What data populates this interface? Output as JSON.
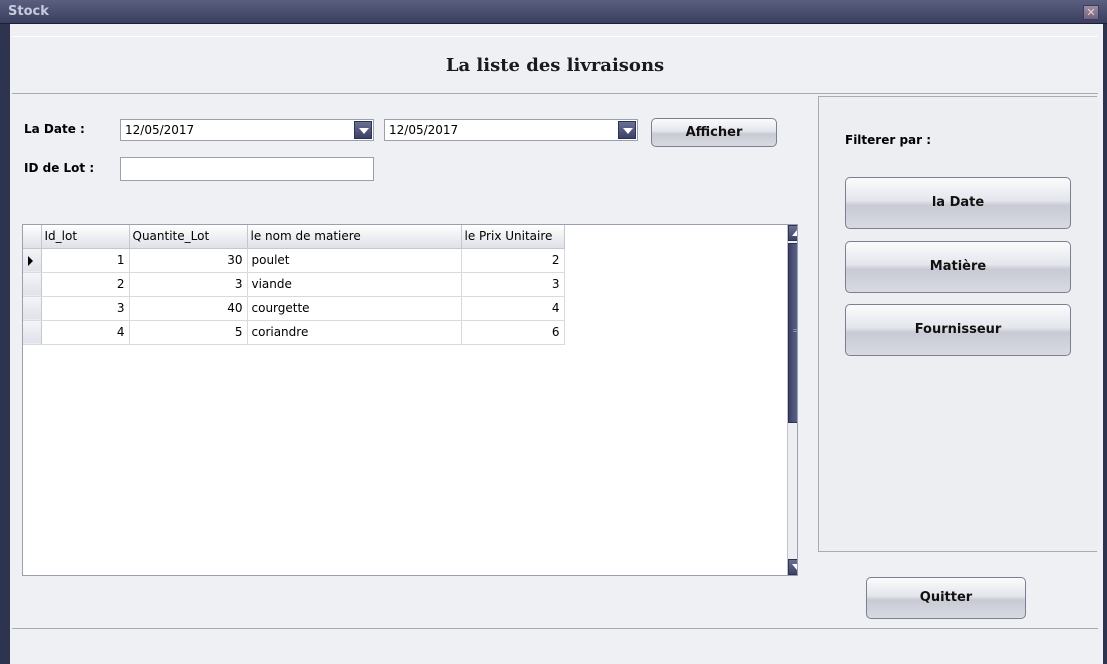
{
  "window": {
    "title": "Stock",
    "close_glyph": "✕"
  },
  "header": {
    "title": "La liste des livraisons"
  },
  "filters": {
    "date_label": "La Date :",
    "date_from": "12/05/2017",
    "date_to": "12/05/2017",
    "lot_label": "ID de Lot :",
    "lot_value": "",
    "afficher_label": "Afficher"
  },
  "side": {
    "filter_label": "Filterer par  :",
    "buttons": [
      "la Date",
      "Matière",
      "Fournisseur"
    ]
  },
  "grid": {
    "columns": [
      "Id_lot",
      "Quantite_Lot",
      "le nom de matiere",
      "le Prix Unitaire"
    ],
    "rows": [
      [
        "1",
        "30",
        "poulet",
        "2"
      ],
      [
        "2",
        "3",
        "viande",
        "3"
      ],
      [
        "3",
        "40",
        "courgette",
        "4"
      ],
      [
        "4",
        "5",
        "coriandre",
        "6"
      ]
    ]
  },
  "footer": {
    "quit_label": "Quitter"
  },
  "colors": {
    "titlebar": "#3a3f5e",
    "background": "#eef0f4",
    "accent": "#3c4266"
  }
}
